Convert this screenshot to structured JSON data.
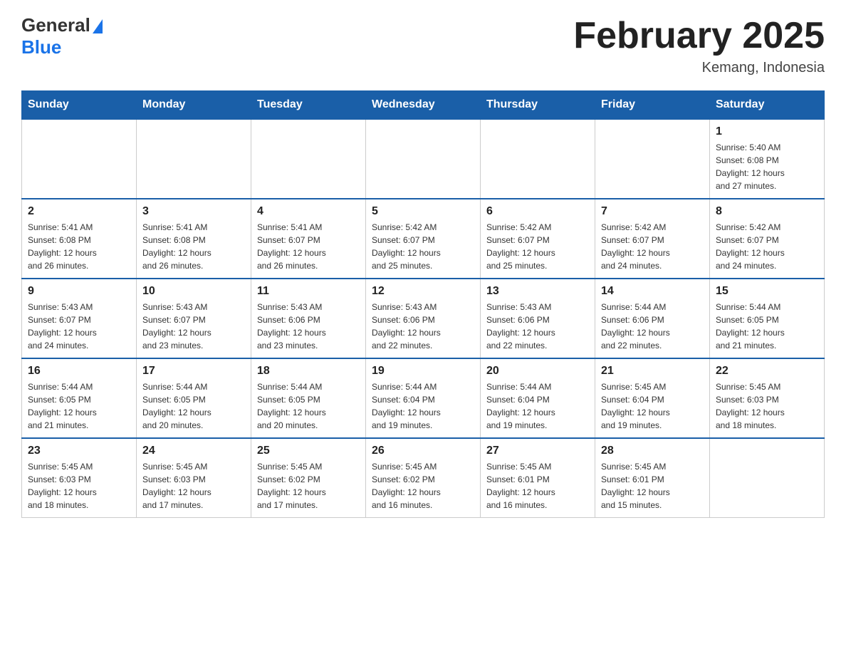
{
  "header": {
    "logo_general": "General",
    "logo_blue": "Blue",
    "month_title": "February 2025",
    "location": "Kemang, Indonesia"
  },
  "days_of_week": [
    "Sunday",
    "Monday",
    "Tuesday",
    "Wednesday",
    "Thursday",
    "Friday",
    "Saturday"
  ],
  "weeks": [
    [
      {
        "day": "",
        "info": ""
      },
      {
        "day": "",
        "info": ""
      },
      {
        "day": "",
        "info": ""
      },
      {
        "day": "",
        "info": ""
      },
      {
        "day": "",
        "info": ""
      },
      {
        "day": "",
        "info": ""
      },
      {
        "day": "1",
        "info": "Sunrise: 5:40 AM\nSunset: 6:08 PM\nDaylight: 12 hours\nand 27 minutes."
      }
    ],
    [
      {
        "day": "2",
        "info": "Sunrise: 5:41 AM\nSunset: 6:08 PM\nDaylight: 12 hours\nand 26 minutes."
      },
      {
        "day": "3",
        "info": "Sunrise: 5:41 AM\nSunset: 6:08 PM\nDaylight: 12 hours\nand 26 minutes."
      },
      {
        "day": "4",
        "info": "Sunrise: 5:41 AM\nSunset: 6:07 PM\nDaylight: 12 hours\nand 26 minutes."
      },
      {
        "day": "5",
        "info": "Sunrise: 5:42 AM\nSunset: 6:07 PM\nDaylight: 12 hours\nand 25 minutes."
      },
      {
        "day": "6",
        "info": "Sunrise: 5:42 AM\nSunset: 6:07 PM\nDaylight: 12 hours\nand 25 minutes."
      },
      {
        "day": "7",
        "info": "Sunrise: 5:42 AM\nSunset: 6:07 PM\nDaylight: 12 hours\nand 24 minutes."
      },
      {
        "day": "8",
        "info": "Sunrise: 5:42 AM\nSunset: 6:07 PM\nDaylight: 12 hours\nand 24 minutes."
      }
    ],
    [
      {
        "day": "9",
        "info": "Sunrise: 5:43 AM\nSunset: 6:07 PM\nDaylight: 12 hours\nand 24 minutes."
      },
      {
        "day": "10",
        "info": "Sunrise: 5:43 AM\nSunset: 6:07 PM\nDaylight: 12 hours\nand 23 minutes."
      },
      {
        "day": "11",
        "info": "Sunrise: 5:43 AM\nSunset: 6:06 PM\nDaylight: 12 hours\nand 23 minutes."
      },
      {
        "day": "12",
        "info": "Sunrise: 5:43 AM\nSunset: 6:06 PM\nDaylight: 12 hours\nand 22 minutes."
      },
      {
        "day": "13",
        "info": "Sunrise: 5:43 AM\nSunset: 6:06 PM\nDaylight: 12 hours\nand 22 minutes."
      },
      {
        "day": "14",
        "info": "Sunrise: 5:44 AM\nSunset: 6:06 PM\nDaylight: 12 hours\nand 22 minutes."
      },
      {
        "day": "15",
        "info": "Sunrise: 5:44 AM\nSunset: 6:05 PM\nDaylight: 12 hours\nand 21 minutes."
      }
    ],
    [
      {
        "day": "16",
        "info": "Sunrise: 5:44 AM\nSunset: 6:05 PM\nDaylight: 12 hours\nand 21 minutes."
      },
      {
        "day": "17",
        "info": "Sunrise: 5:44 AM\nSunset: 6:05 PM\nDaylight: 12 hours\nand 20 minutes."
      },
      {
        "day": "18",
        "info": "Sunrise: 5:44 AM\nSunset: 6:05 PM\nDaylight: 12 hours\nand 20 minutes."
      },
      {
        "day": "19",
        "info": "Sunrise: 5:44 AM\nSunset: 6:04 PM\nDaylight: 12 hours\nand 19 minutes."
      },
      {
        "day": "20",
        "info": "Sunrise: 5:44 AM\nSunset: 6:04 PM\nDaylight: 12 hours\nand 19 minutes."
      },
      {
        "day": "21",
        "info": "Sunrise: 5:45 AM\nSunset: 6:04 PM\nDaylight: 12 hours\nand 19 minutes."
      },
      {
        "day": "22",
        "info": "Sunrise: 5:45 AM\nSunset: 6:03 PM\nDaylight: 12 hours\nand 18 minutes."
      }
    ],
    [
      {
        "day": "23",
        "info": "Sunrise: 5:45 AM\nSunset: 6:03 PM\nDaylight: 12 hours\nand 18 minutes."
      },
      {
        "day": "24",
        "info": "Sunrise: 5:45 AM\nSunset: 6:03 PM\nDaylight: 12 hours\nand 17 minutes."
      },
      {
        "day": "25",
        "info": "Sunrise: 5:45 AM\nSunset: 6:02 PM\nDaylight: 12 hours\nand 17 minutes."
      },
      {
        "day": "26",
        "info": "Sunrise: 5:45 AM\nSunset: 6:02 PM\nDaylight: 12 hours\nand 16 minutes."
      },
      {
        "day": "27",
        "info": "Sunrise: 5:45 AM\nSunset: 6:01 PM\nDaylight: 12 hours\nand 16 minutes."
      },
      {
        "day": "28",
        "info": "Sunrise: 5:45 AM\nSunset: 6:01 PM\nDaylight: 12 hours\nand 15 minutes."
      },
      {
        "day": "",
        "info": ""
      }
    ]
  ]
}
